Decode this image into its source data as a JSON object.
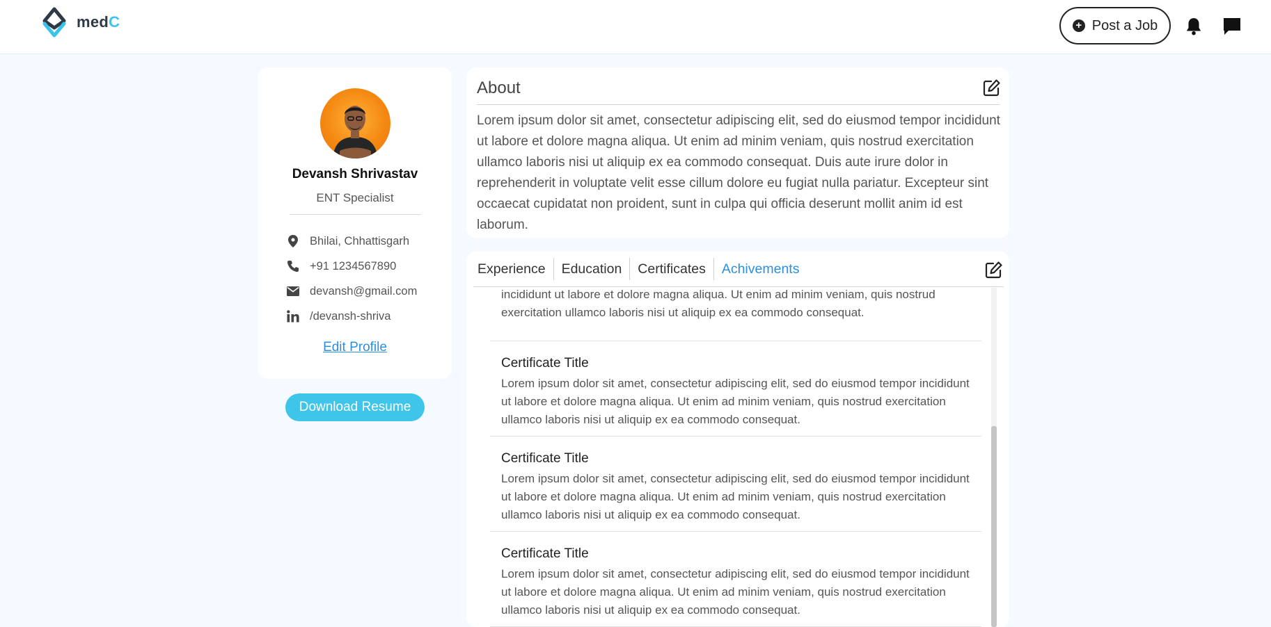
{
  "header": {
    "logo_text_main": "med",
    "logo_text_accent": "C",
    "post_job_label": "Post a Job",
    "icons": [
      "logo-mark",
      "plus-circle-icon",
      "bell-icon",
      "chat-icon"
    ]
  },
  "profile": {
    "name": "Devansh Shrivastav",
    "specialty": "ENT Specialist",
    "location": "Bhilai, Chhattisgarh",
    "phone": "+91 1234567890",
    "email": "devansh@gmail.com",
    "linkedin": "/devansh-shriva",
    "edit_profile_label": "Edit Profile",
    "download_resume_label": "Download Resume"
  },
  "about": {
    "title": "About",
    "text": "Lorem ipsum dolor sit amet, consectetur adipiscing elit, sed do eiusmod tempor incididunt ut labore et dolore magna aliqua. Ut enim ad minim veniam, quis nostrud exercitation ullamco laboris nisi ut aliquip ex ea commodo consequat. Duis aute irure dolor in reprehenderit in voluptate velit esse cillum dolore eu fugiat nulla pariatur. Excepteur sint occaecat cupidatat non proident, sunt in culpa qui officia deserunt mollit anim id est laborum."
  },
  "tabs": [
    {
      "label": "Experience",
      "active": false
    },
    {
      "label": "Education",
      "active": false
    },
    {
      "label": "Certificates",
      "active": false
    },
    {
      "label": "Achivements",
      "active": true
    }
  ],
  "items": {
    "partial_desc": "incididunt ut labore et dolore magna aliqua. Ut enim ad minim veniam, quis nostrud exercitation ullamco laboris nisi ut aliquip ex ea commodo consequat.",
    "list": [
      {
        "title": "Certificate Title",
        "desc": "Lorem ipsum dolor sit amet, consectetur adipiscing elit, sed do eiusmod tempor incididunt ut labore et dolore magna aliqua. Ut enim ad minim veniam, quis nostrud exercitation ullamco laboris nisi ut aliquip ex ea commodo consequat."
      },
      {
        "title": "Certificate Title",
        "desc": "Lorem ipsum dolor sit amet, consectetur adipiscing elit, sed do eiusmod tempor incididunt ut labore et dolore magna aliqua. Ut enim ad minim veniam, quis nostrud exercitation ullamco laboris nisi ut aliquip ex ea commodo consequat."
      },
      {
        "title": "Certificate Title",
        "desc": "Lorem ipsum dolor sit amet, consectetur adipiscing elit, sed do eiusmod tempor incididunt ut labore et dolore magna aliqua. Ut enim ad minim veniam, quis nostrud exercitation ullamco laboris nisi ut aliquip ex ea commodo consequat."
      }
    ]
  },
  "colors": {
    "accent": "#3fc4ea",
    "link": "#2b8fe0",
    "page_bg": "#f4faff",
    "avatar_bg": "#f58a12"
  }
}
